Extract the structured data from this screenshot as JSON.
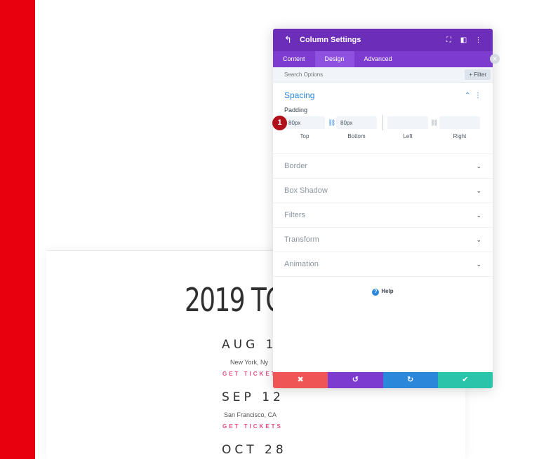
{
  "modal": {
    "title": "Column Settings",
    "tabs": [
      {
        "label": "Content"
      },
      {
        "label": "Design",
        "active": true
      },
      {
        "label": "Advanced"
      }
    ],
    "search_placeholder": "Search Options",
    "filter_label": "+ Filter",
    "spacing": {
      "title": "Spacing",
      "padding_label": "Padding",
      "top": {
        "value": "80px",
        "label": "Top"
      },
      "bottom": {
        "value": "80px",
        "label": "Bottom"
      },
      "left": {
        "value": "",
        "label": "Left"
      },
      "right": {
        "value": "",
        "label": "Right"
      }
    },
    "sections": [
      {
        "label": "Border"
      },
      {
        "label": "Box Shadow"
      },
      {
        "label": "Filters"
      },
      {
        "label": "Transform"
      },
      {
        "label": "Animation"
      }
    ],
    "help_label": "Help",
    "actions": [
      {
        "icon": "close-icon",
        "color": "#ef5555"
      },
      {
        "icon": "undo-icon",
        "color": "#7e3bd0"
      },
      {
        "icon": "redo-icon",
        "color": "#2b87da"
      },
      {
        "icon": "check-icon",
        "color": "#29c4a9"
      }
    ],
    "colors": {
      "header": "#6c2eb9",
      "tabs": "#7e3bd0",
      "accent": "#2b87da"
    }
  },
  "step_badge": "1",
  "page": {
    "title": "2019 TO",
    "events": [
      {
        "date": "AUG 10",
        "city": "New York, Ny",
        "link": "GET TICKETS"
      },
      {
        "date": "SEP 12",
        "city": "San Francisco, CA",
        "link": "GET TICKETS"
      },
      {
        "date": "OCT 28"
      }
    ],
    "colors": {
      "side_bar": "#e8000e",
      "link": "#e64c80"
    }
  }
}
